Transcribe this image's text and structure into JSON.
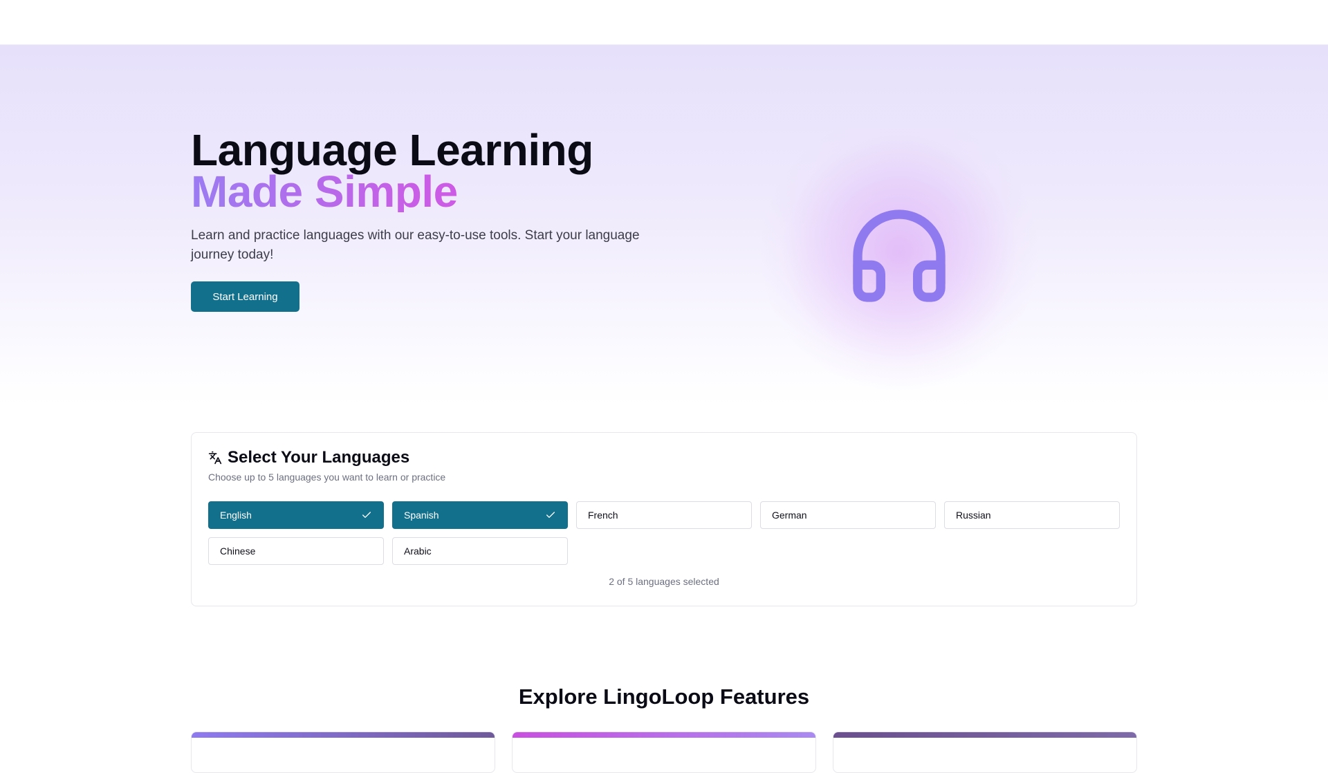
{
  "hero": {
    "title_line1": "Language Learning",
    "title_line2": "Made Simple",
    "subtitle": "Learn and practice languages with our easy-to-use tools. Start your language journey today!",
    "cta_label": "Start Learning",
    "illustration_icon": "headphones-icon"
  },
  "language_picker": {
    "icon": "translate-icon",
    "title": "Select Your Languages",
    "description": "Choose up to 5 languages you want to learn or practice",
    "options": [
      {
        "label": "English",
        "selected": true
      },
      {
        "label": "Spanish",
        "selected": true
      },
      {
        "label": "French",
        "selected": false
      },
      {
        "label": "German",
        "selected": false
      },
      {
        "label": "Russian",
        "selected": false
      },
      {
        "label": "Chinese",
        "selected": false
      },
      {
        "label": "Arabic",
        "selected": false
      }
    ],
    "selection_status": "2 of 5 languages selected"
  },
  "features": {
    "title": "Explore LingoLoop Features",
    "card_stripe_colors": [
      [
        "#8f7af0",
        "#6f5a9a"
      ],
      [
        "#c94fe0",
        "#a98af0"
      ],
      [
        "#6b4f8f",
        "#7e6aa8"
      ]
    ]
  },
  "colors": {
    "primary": "#13708c",
    "gradient_start": "#9b7cf2",
    "gradient_end": "#d94fe0",
    "icon_purple": "#8f7af0"
  }
}
